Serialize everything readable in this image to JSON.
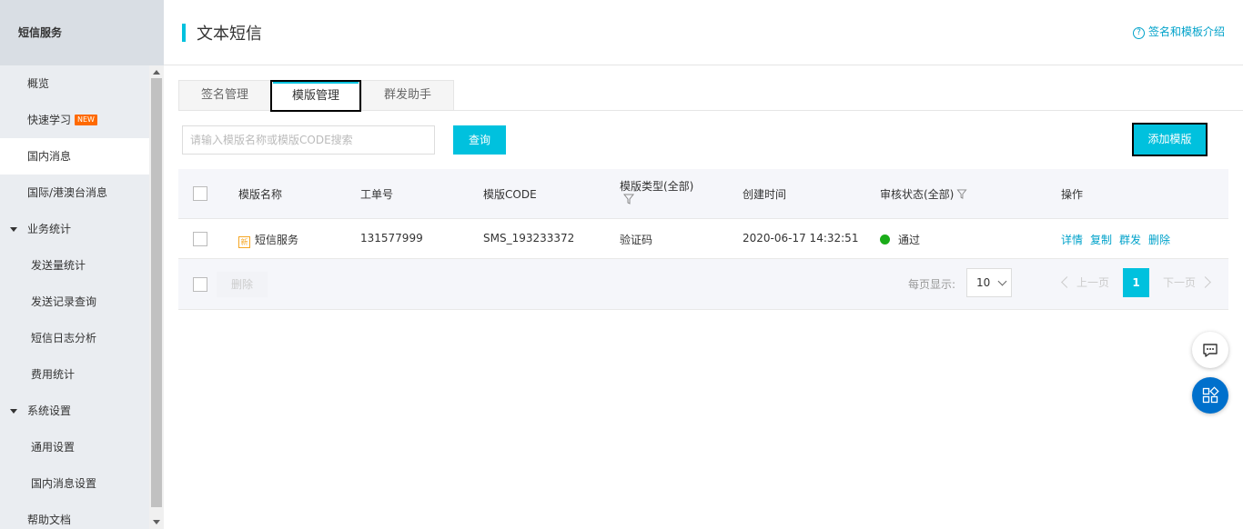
{
  "sidebar": {
    "header": "短信服务",
    "items": [
      {
        "label": "概览"
      },
      {
        "label": "快速学习",
        "badge": "NEW"
      },
      {
        "label": "国内消息"
      },
      {
        "label": "国际/港澳台消息"
      },
      {
        "label": "业务统计"
      },
      {
        "label": "发送量统计"
      },
      {
        "label": "发送记录查询"
      },
      {
        "label": "短信日志分析"
      },
      {
        "label": "费用统计"
      },
      {
        "label": "系统设置"
      },
      {
        "label": "通用设置"
      },
      {
        "label": "国内消息设置"
      },
      {
        "label": "帮助文档"
      }
    ]
  },
  "header": {
    "title": "文本短信",
    "help_link": "签名和模板介绍",
    "help_icon_glyph": "?"
  },
  "tabs": [
    {
      "label": "签名管理"
    },
    {
      "label": "模版管理"
    },
    {
      "label": "群发助手"
    }
  ],
  "search": {
    "placeholder": "请输入模版名称或模版CODE搜索",
    "value": "",
    "query_label": "查询"
  },
  "toolbar": {
    "add_label": "添加模版"
  },
  "table": {
    "columns": {
      "name": "模版名称",
      "ticket": "工单号",
      "code": "模版CODE",
      "type": "模版类型(全部)",
      "created": "创建时间",
      "status": "审核状态(全部)",
      "ops": "操作"
    },
    "rows": [
      {
        "icon_glyph": "新",
        "name": "短信服务",
        "ticket": "131577999",
        "code": "SMS_193233372",
        "type": "验证码",
        "created": "2020-06-17 14:32:51",
        "status": "通过",
        "ops": [
          "详情",
          "复制",
          "群发",
          "删除"
        ]
      }
    ]
  },
  "footer": {
    "delete_label": "删除",
    "page_size_label": "每页显示:",
    "page_size": "10",
    "prev_label": "上一页",
    "current_page": "1",
    "next_label": "下一页"
  },
  "colors": {
    "accent": "#00c1de",
    "link": "#00a2ca",
    "status_ok": "#1aac19",
    "new_badge": "#ff6a00",
    "float_blue": "#0070cc"
  },
  "icons": [
    "help-icon",
    "filter-icon",
    "chat-icon",
    "apps-icon",
    "chevron-down-icon",
    "chevron-left-icon",
    "chevron-right-icon"
  ]
}
